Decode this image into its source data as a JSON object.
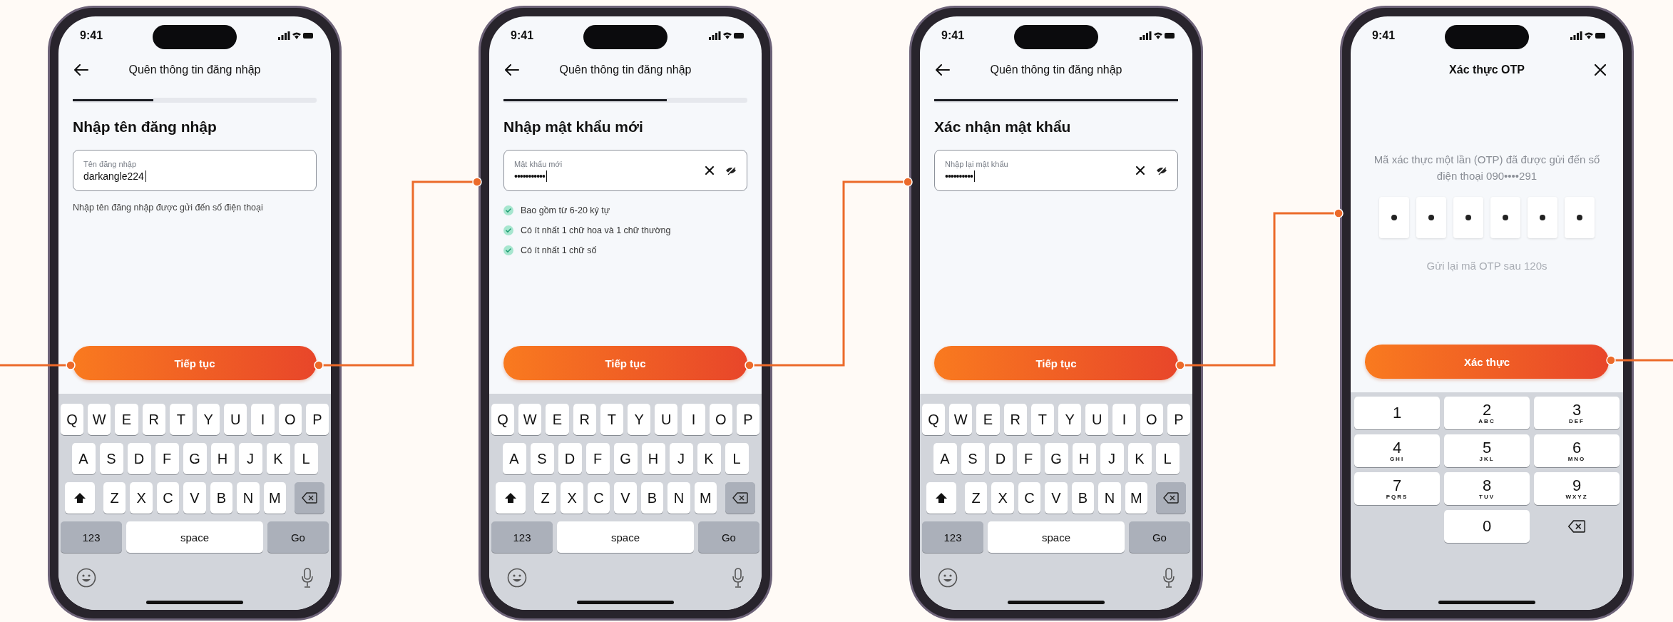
{
  "screens": [
    {
      "kind": "form",
      "status_time": "9:41",
      "header": {
        "kind": "back",
        "title": "Quên thông tin đăng nhập"
      },
      "progress": {
        "level": 0.33
      },
      "heading": "Nhập tên đăng nhập",
      "field": {
        "kind": "text",
        "label": "Tên đăng nhập",
        "value": "darkangle224"
      },
      "helper": "Nhập tên đăng nhập được gửi đến số điện thoại",
      "button": "Tiếp tục",
      "keyboard": {
        "kind": "qwerty",
        "rows": [
          [
            "Q",
            "W",
            "E",
            "R",
            "T",
            "Y",
            "U",
            "I",
            "O",
            "P"
          ],
          [
            "A",
            "S",
            "D",
            "F",
            "G",
            "H",
            "J",
            "K",
            "L"
          ],
          [
            "Z",
            "X",
            "C",
            "V",
            "B",
            "N",
            "M"
          ]
        ],
        "numbers_key": "123",
        "space_key": "space",
        "action_key": "Go"
      }
    },
    {
      "kind": "form",
      "status_time": "9:41",
      "header": {
        "kind": "back",
        "title": "Quên thông tin đăng nhập"
      },
      "progress": {
        "level": 0.67
      },
      "heading": "Nhập mật khẩu mới",
      "field": {
        "kind": "password",
        "label": "Mật khẩu mới",
        "value": "•••••••••••"
      },
      "rules": [
        {
          "text": "Bao gồm từ 6-20 ký tự",
          "checked": true
        },
        {
          "text": "Có ít nhất 1 chữ hoa và 1 chữ thường",
          "checked": true
        },
        {
          "text": "Có ít nhất 1 chữ số",
          "checked": true
        }
      ],
      "button": "Tiếp tục",
      "keyboard": {
        "kind": "qwerty",
        "rows": [
          [
            "Q",
            "W",
            "E",
            "R",
            "T",
            "Y",
            "U",
            "I",
            "O",
            "P"
          ],
          [
            "A",
            "S",
            "D",
            "F",
            "G",
            "H",
            "J",
            "K",
            "L"
          ],
          [
            "Z",
            "X",
            "C",
            "V",
            "B",
            "N",
            "M"
          ]
        ],
        "numbers_key": "123",
        "space_key": "space",
        "action_key": "Go"
      }
    },
    {
      "kind": "form",
      "status_time": "9:41",
      "header": {
        "kind": "back",
        "title": "Quên thông tin đăng nhập"
      },
      "progress": {
        "level": 1
      },
      "heading": "Xác nhận mật khẩu",
      "field": {
        "kind": "password",
        "label": "Nhập lại mật khẩu",
        "value": "••••••••••"
      },
      "button": "Tiếp tục",
      "keyboard": {
        "kind": "qwerty",
        "rows": [
          [
            "Q",
            "W",
            "E",
            "R",
            "T",
            "Y",
            "U",
            "I",
            "O",
            "P"
          ],
          [
            "A",
            "S",
            "D",
            "F",
            "G",
            "H",
            "J",
            "K",
            "L"
          ],
          [
            "Z",
            "X",
            "C",
            "V",
            "B",
            "N",
            "M"
          ]
        ],
        "numbers_key": "123",
        "space_key": "space",
        "action_key": "Go"
      }
    },
    {
      "kind": "otp",
      "status_time": "9:41",
      "header": {
        "kind": "close",
        "title": "Xác thực OTP"
      },
      "message": "Mã xác thực một lần (OTP) đã được gửi đến số điện thoại 090••••291",
      "otp": [
        {
          "filled": true
        },
        {
          "filled": true
        },
        {
          "filled": true
        },
        {
          "filled": true
        },
        {
          "filled": true
        },
        {
          "filled": true
        }
      ],
      "resend": "Gửi lại mã OTP sau 120s",
      "button": "Xác thực",
      "keyboard": {
        "kind": "numpad",
        "keys": [
          {
            "digit": "1"
          },
          {
            "digit": "2",
            "letters": "ABC"
          },
          {
            "digit": "3",
            "letters": "DEF"
          },
          {
            "digit": "4",
            "letters": "GHI"
          },
          {
            "digit": "5",
            "letters": "JKL"
          },
          {
            "digit": "6",
            "letters": "MNO"
          },
          {
            "digit": "7",
            "letters": "PQRS"
          },
          {
            "digit": "8",
            "letters": "TUV"
          },
          {
            "digit": "9",
            "letters": "WXYZ"
          },
          {
            "digit": "0"
          }
        ]
      }
    }
  ]
}
